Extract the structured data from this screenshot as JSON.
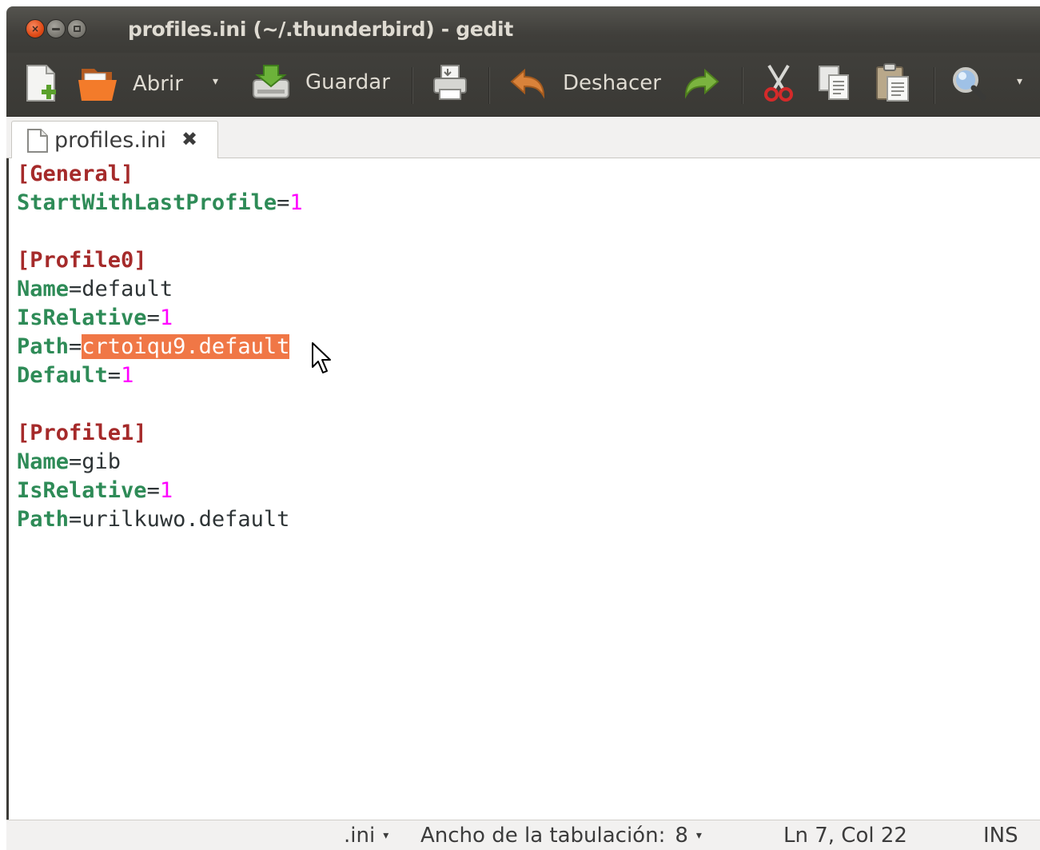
{
  "window": {
    "title": "profiles.ini (~/.thunderbird) - gedit",
    "controls": {
      "close": "×"
    }
  },
  "toolbar": {
    "new_icon": "new-document-icon",
    "open_label": "Abrir",
    "save_label": "Guardar",
    "print_icon": "printer-icon",
    "undo_label": "Deshacer",
    "redo_icon": "redo-icon",
    "cut_icon": "scissors-icon",
    "copy_icon": "copy-icon",
    "paste_icon": "paste-icon",
    "search_icon": "magnifier-icon",
    "dropdown_glyph": "▾"
  },
  "tab": {
    "label": "profiles.ini",
    "close_glyph": "✖"
  },
  "editor": {
    "lines": [
      {
        "section": "[General]"
      },
      {
        "key": "StartWithLastProfile",
        "value": "1",
        "numeric": true
      },
      {},
      {
        "section": "[Profile0]"
      },
      {
        "key": "Name",
        "value": "default"
      },
      {
        "key": "IsRelative",
        "value": "1",
        "numeric": true
      },
      {
        "key": "Path",
        "value": "crtoiqu9.default",
        "selected": true
      },
      {
        "key": "Default",
        "value": "1",
        "numeric": true
      },
      {},
      {
        "section": "[Profile1]"
      },
      {
        "key": "Name",
        "value": "gib"
      },
      {
        "key": "IsRelative",
        "value": "1",
        "numeric": true
      },
      {
        "key": "Path",
        "value": "urilkuwo.default"
      }
    ],
    "equals": "=",
    "selection_color": "#f07746",
    "key_color": "#2e8b57",
    "section_color": "#a52a2a",
    "number_color": "#ff00ff"
  },
  "statusbar": {
    "language": ".ini",
    "tab_width_label": "Ancho de la tabulación:",
    "tab_width_value": "8",
    "position": "Ln 7, Col 22",
    "mode": "INS",
    "dropdown_glyph": "▾"
  }
}
